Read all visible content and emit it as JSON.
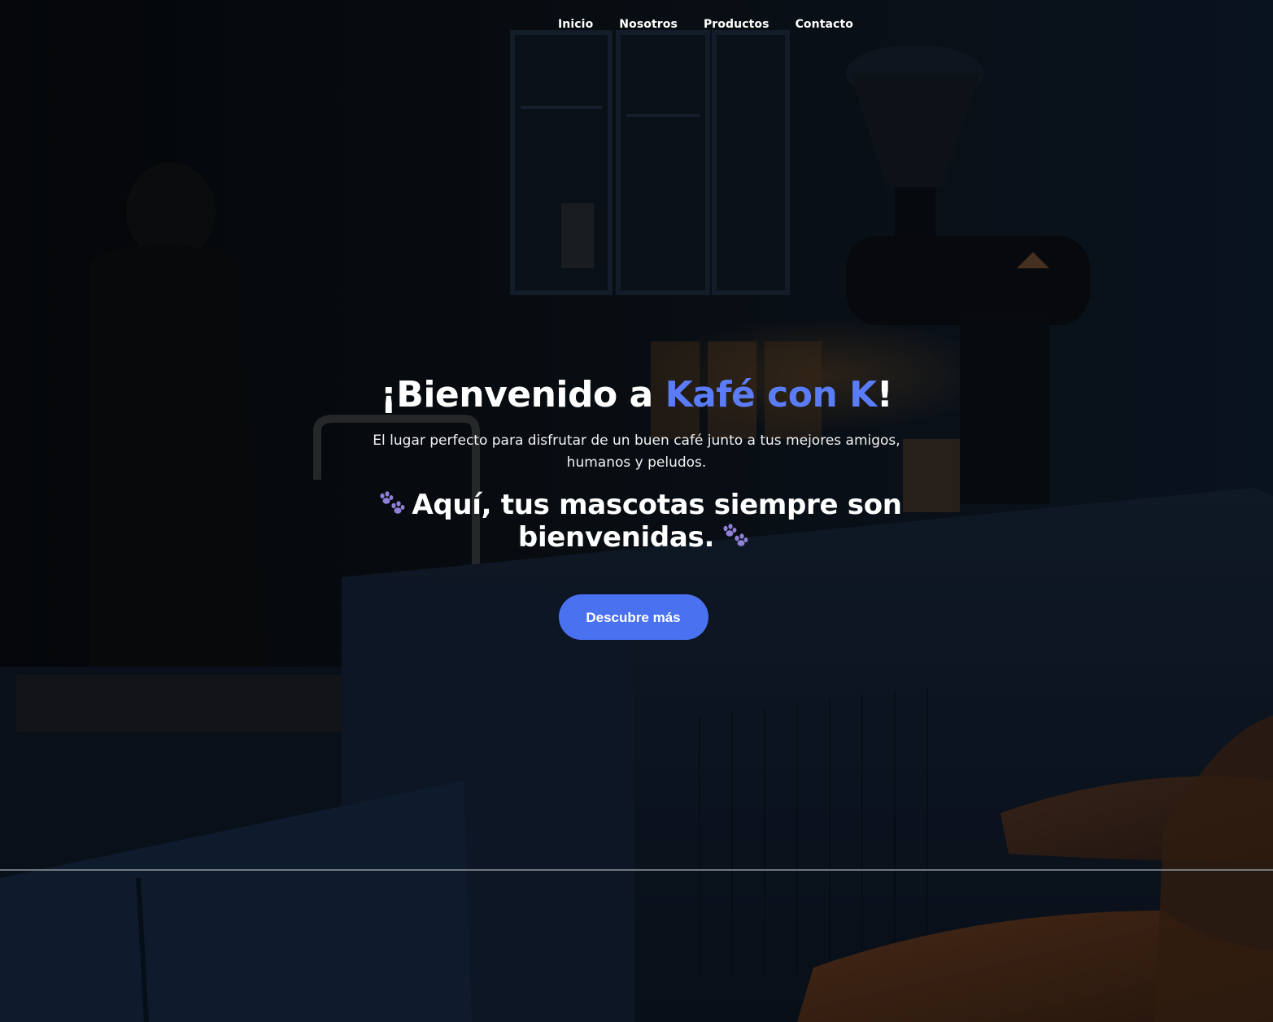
{
  "nav": {
    "items": [
      {
        "label": "Inicio"
      },
      {
        "label": "Nosotros"
      },
      {
        "label": "Productos"
      },
      {
        "label": "Contacto"
      }
    ]
  },
  "hero": {
    "title_prefix": "¡Bienvenido a ",
    "title_brand": "Kafé con K",
    "title_suffix": "!",
    "description": "El lugar perfecto para disfrutar de un buen café junto a tus mejores amigos, humanos y peludos.",
    "tagline": "Aquí, tus mascotas siempre son bienvenidas.",
    "cta_label": "Descubre más"
  },
  "colors": {
    "brand": "#5b7cf7",
    "button": "#4a72f0",
    "paw": "#8f7fd6"
  },
  "icons": {
    "paw_left": "paw-prints-icon",
    "paw_right": "paw-prints-icon"
  }
}
